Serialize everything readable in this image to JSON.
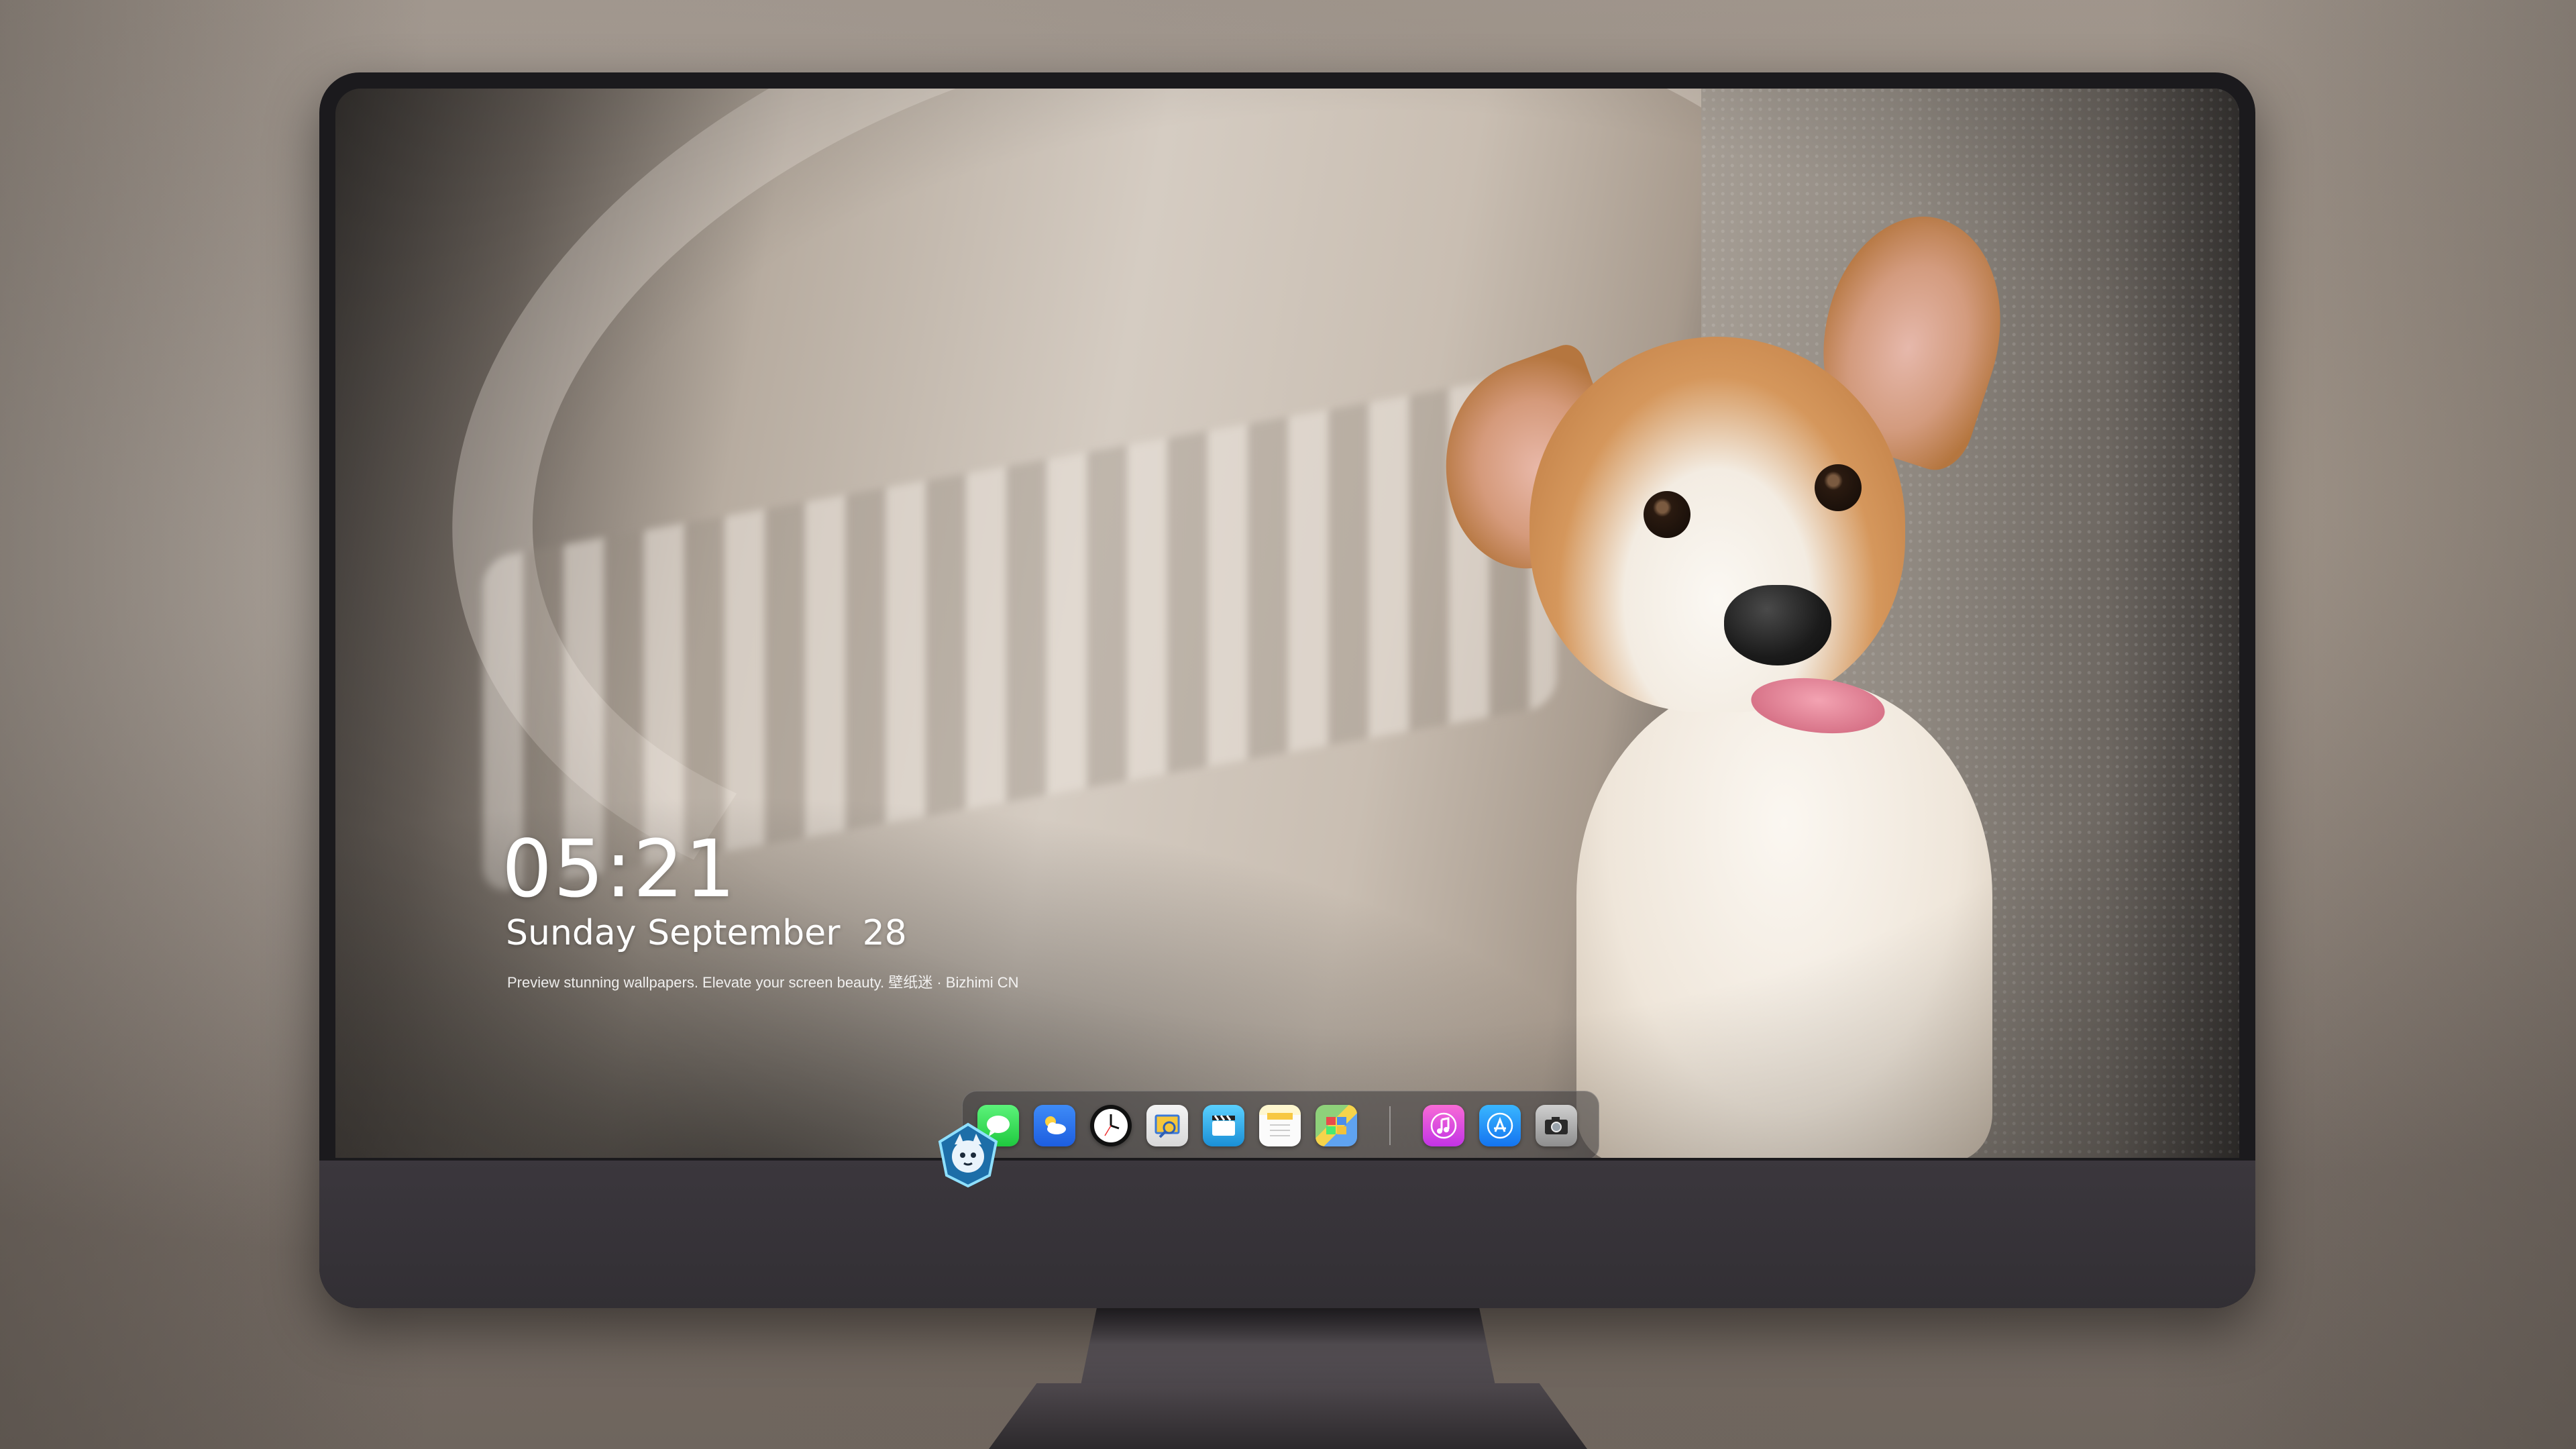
{
  "lock_screen": {
    "time": "05:21",
    "date": "Sunday September  28",
    "tagline": "Preview stunning wallpapers. Elevate your screen beauty. 壁纸迷 · Bizhimi CN"
  },
  "dock": {
    "apps": [
      {
        "icon": "messages-icon"
      },
      {
        "icon": "weather-icon"
      },
      {
        "icon": "clock-icon"
      },
      {
        "icon": "preview-icon"
      },
      {
        "icon": "clips-icon"
      },
      {
        "icon": "notes-icon"
      },
      {
        "icon": "maps-icon"
      },
      {
        "icon": "music-icon"
      },
      {
        "icon": "app-store-icon"
      },
      {
        "icon": "camera-icon"
      }
    ]
  },
  "device": {
    "chin_logo": "mascot-logo-icon"
  },
  "colors": {
    "bezel": "#1b1a1d",
    "chin": "#37333a",
    "text": "#ffffff"
  }
}
